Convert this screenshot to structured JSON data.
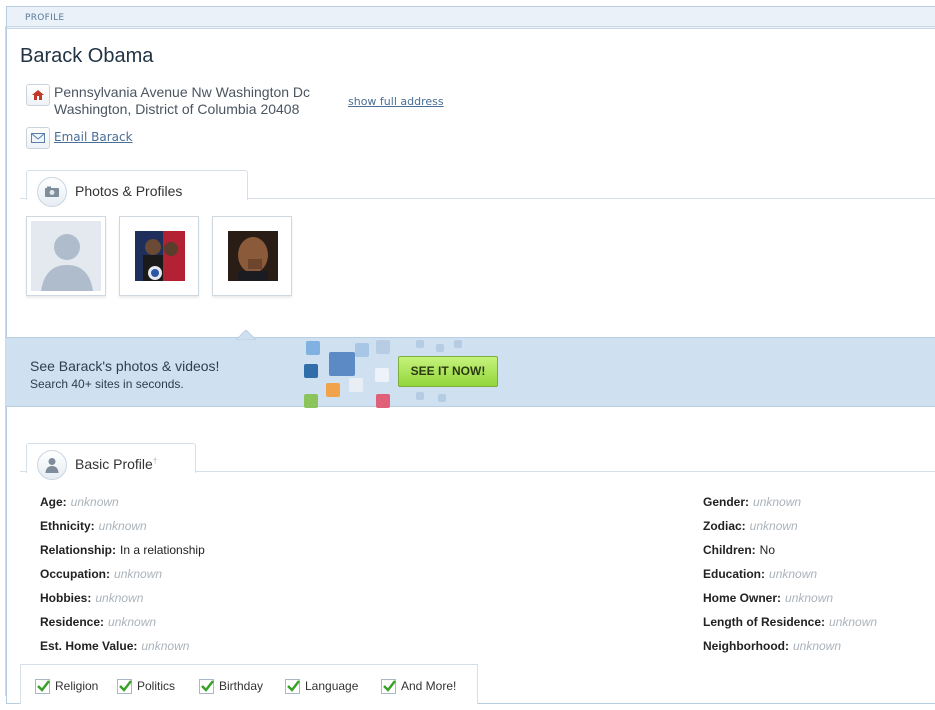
{
  "header": {
    "section_label": "PROFILE"
  },
  "person": {
    "name": "Barack Obama",
    "address_line1": "Pennsylvania Avenue Nw Washington Dc",
    "address_line2": "Washington, District of Columbia 20408",
    "show_address_link": "show full address",
    "email_link": "Email Barack"
  },
  "photos_tab": {
    "label": "Photos & Profiles"
  },
  "photos": [
    {
      "type": "placeholder-silhouette"
    },
    {
      "type": "campaign-photo"
    },
    {
      "type": "portrait-photo"
    }
  ],
  "banner": {
    "headline": "See Barack's photos & videos!",
    "subtext": "Search 40+ sites in seconds.",
    "cta_label": "SEE IT NOW!"
  },
  "basic_tab": {
    "label": "Basic Profile",
    "marker": "†"
  },
  "profile_left": [
    {
      "label": "Age",
      "value": "unknown",
      "known": false
    },
    {
      "label": "Ethnicity",
      "value": "unknown",
      "known": false
    },
    {
      "label": "Relationship",
      "value": "In a relationship",
      "known": true
    },
    {
      "label": "Occupation",
      "value": "unknown",
      "known": false
    },
    {
      "label": "Hobbies",
      "value": "unknown",
      "known": false
    },
    {
      "label": "Residence",
      "value": "unknown",
      "known": false
    },
    {
      "label": "Est. Home Value",
      "value": "unknown",
      "known": false
    }
  ],
  "profile_right": [
    {
      "label": "Gender",
      "value": "unknown",
      "known": false
    },
    {
      "label": "Zodiac",
      "value": "unknown",
      "known": false
    },
    {
      "label": "Children",
      "value": "No",
      "known": true
    },
    {
      "label": "Education",
      "value": "unknown",
      "known": false
    },
    {
      "label": "Home Owner",
      "value": "unknown",
      "known": false
    },
    {
      "label": "Length of Residence",
      "value": "unknown",
      "known": false
    },
    {
      "label": "Neighborhood",
      "value": "unknown",
      "known": false
    }
  ],
  "checklist": [
    "Religion",
    "Politics",
    "Birthday",
    "Language",
    "And More!"
  ],
  "colors": {
    "accent": "#4a6e95",
    "banner_bg": "#cfe1f1",
    "cta_green": "#93d63c",
    "check": "#3aa12a"
  }
}
